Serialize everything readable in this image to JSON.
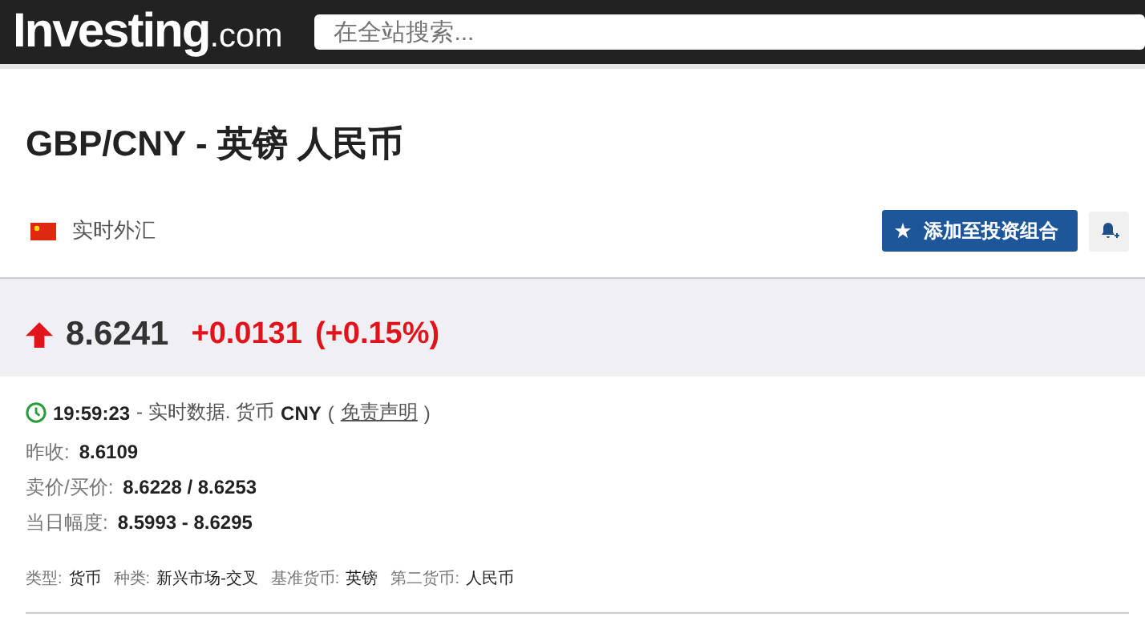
{
  "header": {
    "logo": "Investing",
    "logo_suffix": ".com",
    "search": {
      "placeholder": "在全站搜索..."
    }
  },
  "title": "GBP/CNY - 英镑 人民币",
  "market": "实时外汇",
  "add_button": "添加至投资组合",
  "quote": {
    "rising": true,
    "price": "8.6241",
    "change": "+0.0131",
    "change_pct": "(+0.15%)"
  },
  "status": {
    "time": "19:59:23",
    "text": "- 实时数据. 货币",
    "currency": "CNY",
    "open_paren": "(",
    "disclaimer": "免责声明",
    "close_paren": ")"
  },
  "stats": [
    {
      "label": "昨收:",
      "value": "8.6109"
    },
    {
      "label": "卖价/买价:",
      "value": "8.6228 / 8.6253"
    },
    {
      "label": "当日幅度:",
      "value": "8.5993 - 8.6295"
    }
  ],
  "details": [
    {
      "label": "类型:",
      "value": "货币"
    },
    {
      "label": "种类:",
      "value": "新兴市场-交叉"
    },
    {
      "label": "基准货币:",
      "value": "英镑"
    },
    {
      "label": "第二货币:",
      "value": "人民币"
    }
  ]
}
